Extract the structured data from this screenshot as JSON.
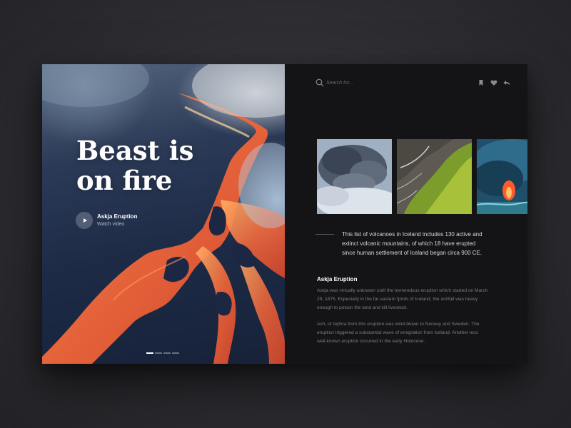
{
  "hero": {
    "title_line1": "Beast is",
    "title_line2": "on fire",
    "video_title": "Askja Eruption",
    "video_subtitle": "Watch video",
    "pager_count": 4,
    "pager_active": 0
  },
  "search": {
    "placeholder": "Search for..."
  },
  "toolbar": {
    "icons": [
      "bookmark-icon",
      "heart-icon",
      "reply-icon"
    ]
  },
  "thumbnails": [
    {
      "name": "ash-cloud-thumbnail"
    },
    {
      "name": "green-ridge-thumbnail"
    },
    {
      "name": "lava-glow-thumbnail"
    }
  ],
  "intro": "This list of volcanoes in Iceland includes 130 active and extinct volcanic mountains, of which 18 have erupted since human settlement of Iceland began circa 900 CE.",
  "article": {
    "title": "Askja Eruption",
    "paragraph1": "Askja was virtually unknown until the tremendous eruption which started on March 29, 1875. Especially in the far eastern fjords of Iceland, the ashfall was heavy enough to poison the land and kill livestock.",
    "paragraph2": "Ash, or tephra from this eruption was wind-blown to Norway and Sweden. The eruption triggered a substantial wave of emigration from Iceland. Another less well-known eruption occurred in the early Holocene."
  },
  "colors": {
    "panel_bg": "#141416",
    "lava": "#f0673a",
    "lava_hot": "#ffb066",
    "rock": "#1d2b47"
  }
}
